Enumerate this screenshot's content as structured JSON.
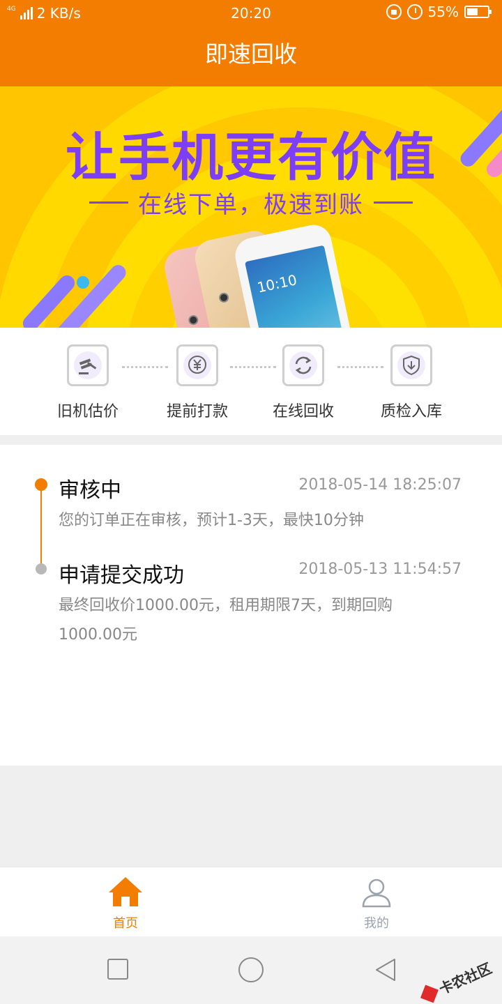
{
  "status_bar": {
    "network_type": "4G",
    "speed": "2 KB/s",
    "time": "20:20",
    "battery": "55%",
    "battery_level": 0.55
  },
  "header": {
    "title": "即速回收"
  },
  "banner": {
    "title": "让手机更有价值",
    "subtitle": "在线下单，极速到账",
    "phone_time": "10:10"
  },
  "steps": [
    {
      "label": "旧机估价",
      "icon": "gavel-icon"
    },
    {
      "label": "提前打款",
      "icon": "yuan-icon"
    },
    {
      "label": "在线回收",
      "icon": "refresh-icon"
    },
    {
      "label": "质检入库",
      "icon": "shield-download-icon"
    }
  ],
  "timeline": [
    {
      "title": "审核中",
      "time": "2018-05-14 18:25:07",
      "description": "您的订单正在审核，预计1-3天，最快10分钟",
      "active": true
    },
    {
      "title": "申请提交成功",
      "time": "2018-05-13 11:54:57",
      "description": "最终回收价1000.00元，租用期限7天，到期回购1000.00元",
      "active": false
    }
  ],
  "bottom_nav": {
    "home": "首页",
    "mine": "我的",
    "active": "home"
  },
  "watermark": "卡农社区",
  "colors": {
    "primary": "#f27d00",
    "accent_purple": "#7c3ff5",
    "banner_yellow": "#ffd700",
    "inactive_gray": "#9aa3ad"
  }
}
